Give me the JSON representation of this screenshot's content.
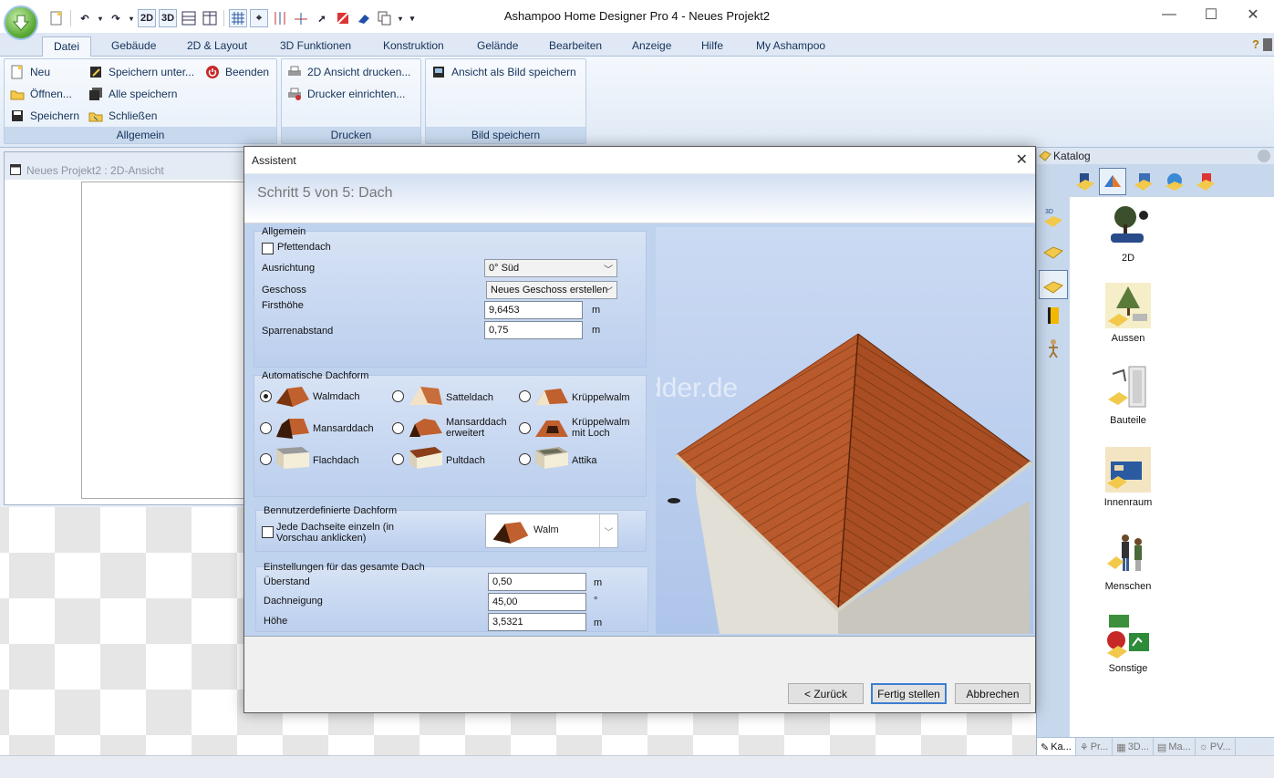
{
  "window": {
    "title": "Ashampoo Home Designer Pro 4 - Neues Projekt2",
    "controls": [
      "—",
      "☐",
      "✕"
    ]
  },
  "quick_access": {
    "btn_2d": "2D",
    "btn_3d": "3D"
  },
  "ribbon": {
    "tabs": [
      {
        "label": "Datei",
        "active": true
      },
      {
        "label": "Gebäude"
      },
      {
        "label": "2D & Layout"
      },
      {
        "label": "3D Funktionen"
      },
      {
        "label": "Konstruktion"
      },
      {
        "label": "Gelände"
      },
      {
        "label": "Bearbeiten"
      },
      {
        "label": "Anzeige"
      },
      {
        "label": "Hilfe"
      },
      {
        "label": "My Ashampoo"
      }
    ],
    "help": "?",
    "groups": {
      "allgemein": {
        "title": "Allgemein",
        "items": [
          "Neu",
          "Öffnen...",
          "Speichern",
          "Speichern unter...",
          "Alle speichern",
          "Schließen",
          "Beenden"
        ]
      },
      "drucken": {
        "title": "Drucken",
        "items": [
          "2D Ansicht drucken...",
          "Drucker einrichten..."
        ]
      },
      "bild": {
        "title": "Bild speichern",
        "items": [
          "Ansicht als Bild speichern"
        ]
      }
    }
  },
  "doc_pane": {
    "title": "Neues Projekt2 : 2D-Ansicht"
  },
  "catalog": {
    "title": "Katalog",
    "entries": [
      "2D",
      "Aussen",
      "Bauteile",
      "Innenraum",
      "Menschen",
      "Sonstige"
    ],
    "tabs": [
      "Ka...",
      "Pr...",
      "3D...",
      "Ma...",
      "PV..."
    ]
  },
  "dialog": {
    "title": "Assistent",
    "step": "Schritt 5 von 5:  Dach",
    "allgemein": {
      "title": "Allgemein",
      "pfettendach": "Pfettendach",
      "ausrichtung_label": "Ausrichtung",
      "ausrichtung_value": "0° Süd",
      "geschoss_label": "Geschoss",
      "geschoss_value": "Neues Geschoss erstellen",
      "firsthoehe_label": "Firsthöhe",
      "firsthoehe_value": "9,6453",
      "sparrenabstand_label": "Sparrenabstand",
      "sparrenabstand_value": "0,75",
      "unit_m": "m"
    },
    "auto_dachform": {
      "title": "Automatische Dachform",
      "options": [
        {
          "label": "Walmdach",
          "selected": true
        },
        {
          "label": "Satteldach"
        },
        {
          "label": "Krüppelwalm"
        },
        {
          "label": "Mansarddach"
        },
        {
          "label": "Mansarddach erweitert"
        },
        {
          "label": "Krüppelwalm mit Loch"
        },
        {
          "label": "Flachdach"
        },
        {
          "label": "Pultdach"
        },
        {
          "label": "Attika"
        }
      ]
    },
    "custom_dachform": {
      "title": "Bennutzerdefinierte Dachform",
      "checkbox_label": "Jede Dachseite einzeln (in Vorschau anklicken)",
      "select_value": "Walm"
    },
    "gesamt": {
      "title": "Einstellungen für das gesamte Dach",
      "ueberstand_label": "Überstand",
      "ueberstand_value": "0,50",
      "ueberstand_unit": "m",
      "dachneigung_label": "Dachneigung",
      "dachneigung_value": "45,00",
      "dachneigung_unit": "°",
      "hoehe_label": "Höhe",
      "hoehe_value": "3,5321",
      "hoehe_unit": "m"
    },
    "watermark": "Deskmodder.de",
    "buttons": {
      "back": "< Zurück",
      "finish": "Fertig stellen",
      "cancel": "Abbrechen"
    }
  },
  "colors": {
    "ribbon_bg": "#dfe9f5",
    "dialog_panel": "#bfd3ef",
    "roof_tile": "#b5582b",
    "wall": "#e2dfd6",
    "accent_blue": "#3c7fd0"
  }
}
